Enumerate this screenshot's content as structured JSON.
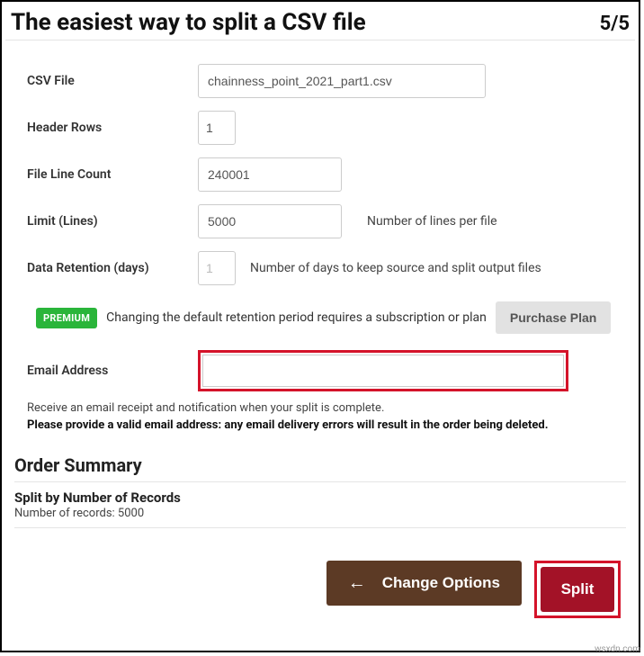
{
  "header": {
    "title": "The easiest way to split a CSV file",
    "step": "5/5"
  },
  "form": {
    "csv_file": {
      "label": "CSV File",
      "value": "chainness_point_2021_part1.csv"
    },
    "header_rows": {
      "label": "Header Rows",
      "value": "1"
    },
    "file_line_count": {
      "label": "File Line Count",
      "value": "240001"
    },
    "limit": {
      "label": "Limit (Lines)",
      "value": "5000",
      "hint": "Number of lines per file"
    },
    "retention": {
      "label": "Data Retention (days)",
      "value": "1",
      "hint": "Number of days to keep source and split output files"
    },
    "email": {
      "label": "Email Address",
      "value": ""
    }
  },
  "premium": {
    "badge": "PREMIUM",
    "text": "Changing the default retention period requires a subscription or plan",
    "button": "Purchase Plan"
  },
  "notes": {
    "line1": "Receive an email receipt and notification when your split is complete.",
    "line2": "Please provide a valid email address: any email delivery errors will result in the order being deleted."
  },
  "order": {
    "heading": "Order Summary",
    "title": "Split by Number of Records",
    "subtitle": "Number of records: 5000"
  },
  "actions": {
    "change": "Change Options",
    "split": "Split"
  },
  "watermark": "wsxdn.com"
}
